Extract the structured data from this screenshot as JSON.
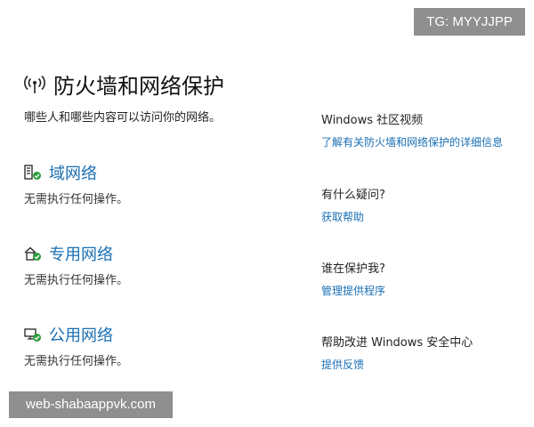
{
  "watermarks": {
    "top_right": "TG: MYYJJPP",
    "bottom_left": "web-shabaappvk.com"
  },
  "header": {
    "title": "防火墙和网络保护",
    "subtitle": "哪些人和哪些内容可以访问你的网络。",
    "icon": "wireless-antenna-icon"
  },
  "networks": [
    {
      "label": "域网络",
      "status": "无需执行任何操作。",
      "icon": "domain-network-icon"
    },
    {
      "label": "专用网络",
      "status": "无需执行任何操作。",
      "icon": "private-network-icon"
    },
    {
      "label": "公用网络",
      "status": "无需执行任何操作。",
      "icon": "public-network-icon"
    }
  ],
  "sidebar": [
    {
      "heading": "Windows 社区视频",
      "link": "了解有关防火墙和网络保护的详细信息"
    },
    {
      "heading": "有什么疑问?",
      "link": "获取帮助"
    },
    {
      "heading": "谁在保护我?",
      "link": "管理提供程序"
    },
    {
      "heading": "帮助改进 Windows 安全中心",
      "link": "提供反馈"
    }
  ],
  "colors": {
    "link": "#1a6fb3",
    "status_ok": "#2a9d3a",
    "watermark_bg": "#8f8f8f"
  }
}
